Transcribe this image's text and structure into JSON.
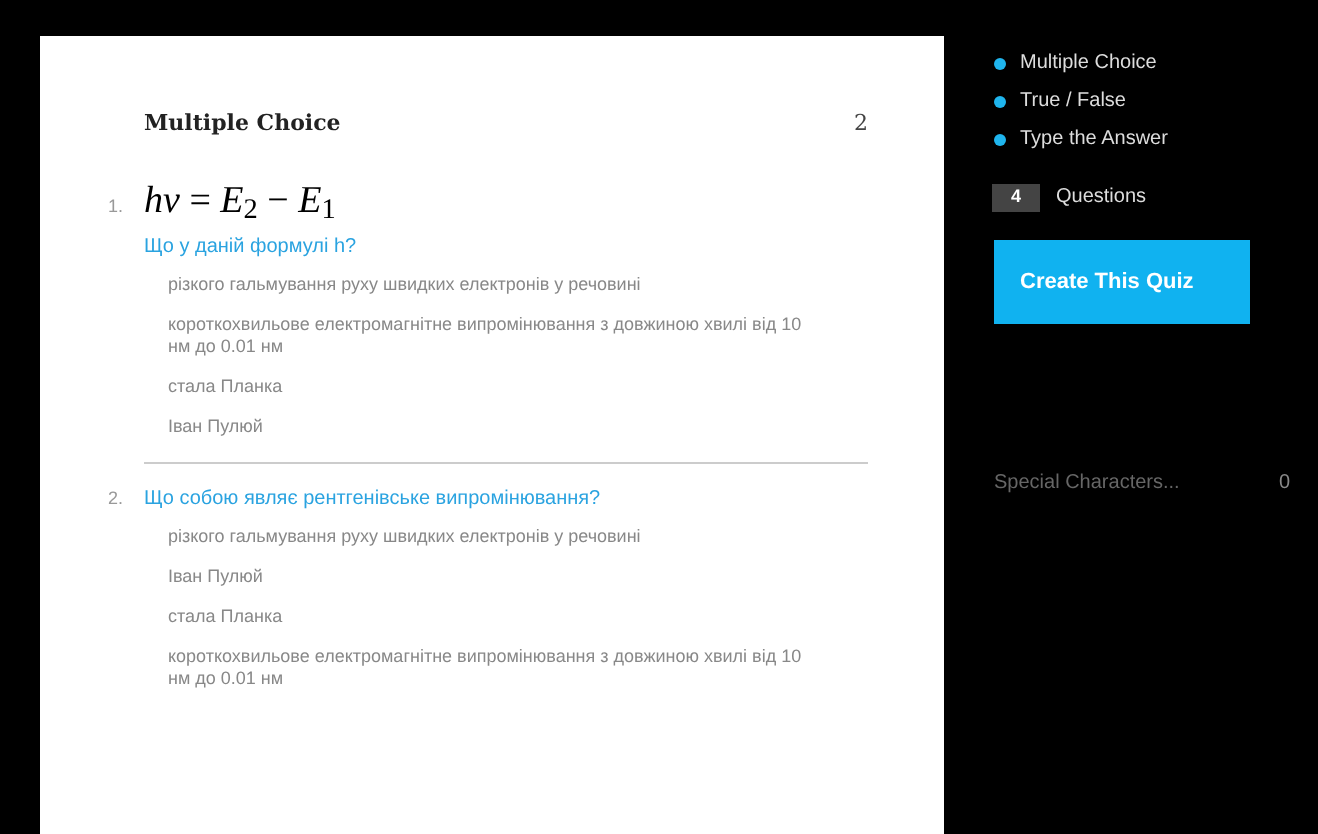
{
  "section": {
    "title": "Multiple Choice",
    "count": "2"
  },
  "questions": [
    {
      "number": "1.",
      "formula": "*hν* = *E*$_{2}$ − *E*$_{1}$",
      "prompt": "Що у даній формулі h?",
      "answers": [
        "різкого гальмування руху швидких електронів у речовині",
        "короткохвильове електромагнітне випромінювання з довжиною хвилі від 10 нм до 0.01 нм",
        "стала Планка",
        "Іван Пулюй"
      ]
    },
    {
      "number": "2.",
      "prompt": "Що собою являє рентгенівське випромінювання?",
      "answers": [
        "різкого гальмування руху швидких електронів у речовині",
        "Іван Пулюй",
        "стала Планка",
        "короткохвильове електромагнітне випромінювання з довжиною хвилі від 10 нм до 0.01 нм"
      ]
    }
  ],
  "sidebar": {
    "types": [
      {
        "label": "Multiple Choice",
        "color": "#1fb5ee"
      },
      {
        "label": "True / False",
        "color": "#1fb5ee"
      },
      {
        "label": "Type the Answer",
        "color": "#1fb5ee"
      }
    ],
    "question_count": "4",
    "questions_label": "Questions",
    "create_button": "Create This Quiz",
    "special_characters": "Special Characters...",
    "special_count": "0"
  }
}
